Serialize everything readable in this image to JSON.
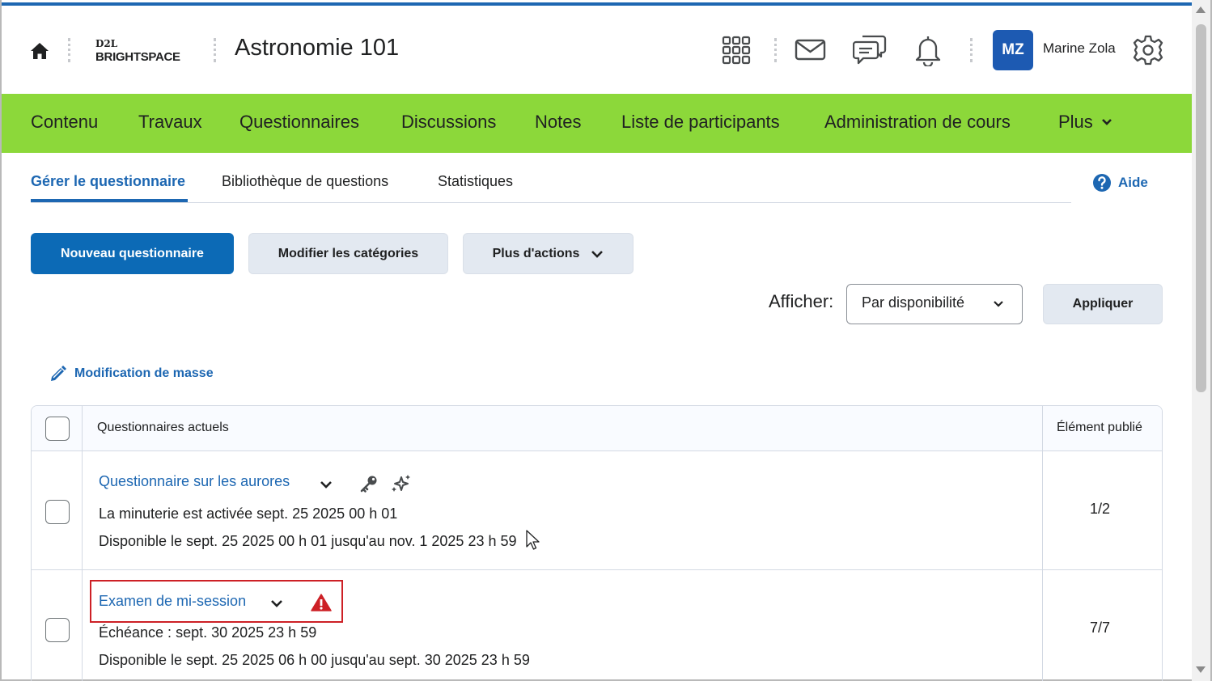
{
  "header": {
    "logo_top": "D2L",
    "logo_bottom": "BRIGHTSPACE",
    "course_title": "Astronomie 101",
    "user_initials": "MZ",
    "user_name": "Marine Zola",
    "accent_color": "#1d67b2",
    "avatar_color": "#1d5ab2"
  },
  "navbar": {
    "color": "#8cd83a",
    "items": [
      "Contenu",
      "Travaux",
      "Questionnaires",
      "Discussions",
      "Notes",
      "Liste de participants",
      "Administration de cours",
      "Plus"
    ]
  },
  "tabs": {
    "items": [
      "Gérer le questionnaire",
      "Bibliothèque de questions",
      "Statistiques"
    ],
    "active": "Gérer le questionnaire",
    "help_label": "Aide"
  },
  "actions": {
    "new_quiz": "Nouveau questionnaire",
    "edit_categories": "Modifier les catégories",
    "more_actions": "Plus d'actions",
    "show_label": "Afficher:",
    "show_value": "Par disponibilité",
    "apply": "Appliquer",
    "mass_edit": "Modification de masse"
  },
  "table": {
    "col_quizzes": "Questionnaires actuels",
    "col_published": "Élément publié",
    "rows": [
      {
        "title": "Questionnaire sur les aurores",
        "line1": "La minuterie est activée sept. 25 2025 00 h 01",
        "line2": "Disponible le sept. 25 2025 00 h 01 jusqu'au nov. 1 2025 23 h 59",
        "published": "1/2",
        "icons": [
          "key-icon",
          "sparkle-icon"
        ]
      },
      {
        "title": "Examen de mi-session",
        "line1": "Échéance : sept. 30 2025 23 h 59",
        "line2": "Disponible le sept. 25 2025 06 h 00 jusqu'au sept. 30 2025 23 h 59",
        "published": "7/7",
        "icons": [
          "warning-icon"
        ],
        "warning_color": "#cd2026"
      }
    ]
  }
}
